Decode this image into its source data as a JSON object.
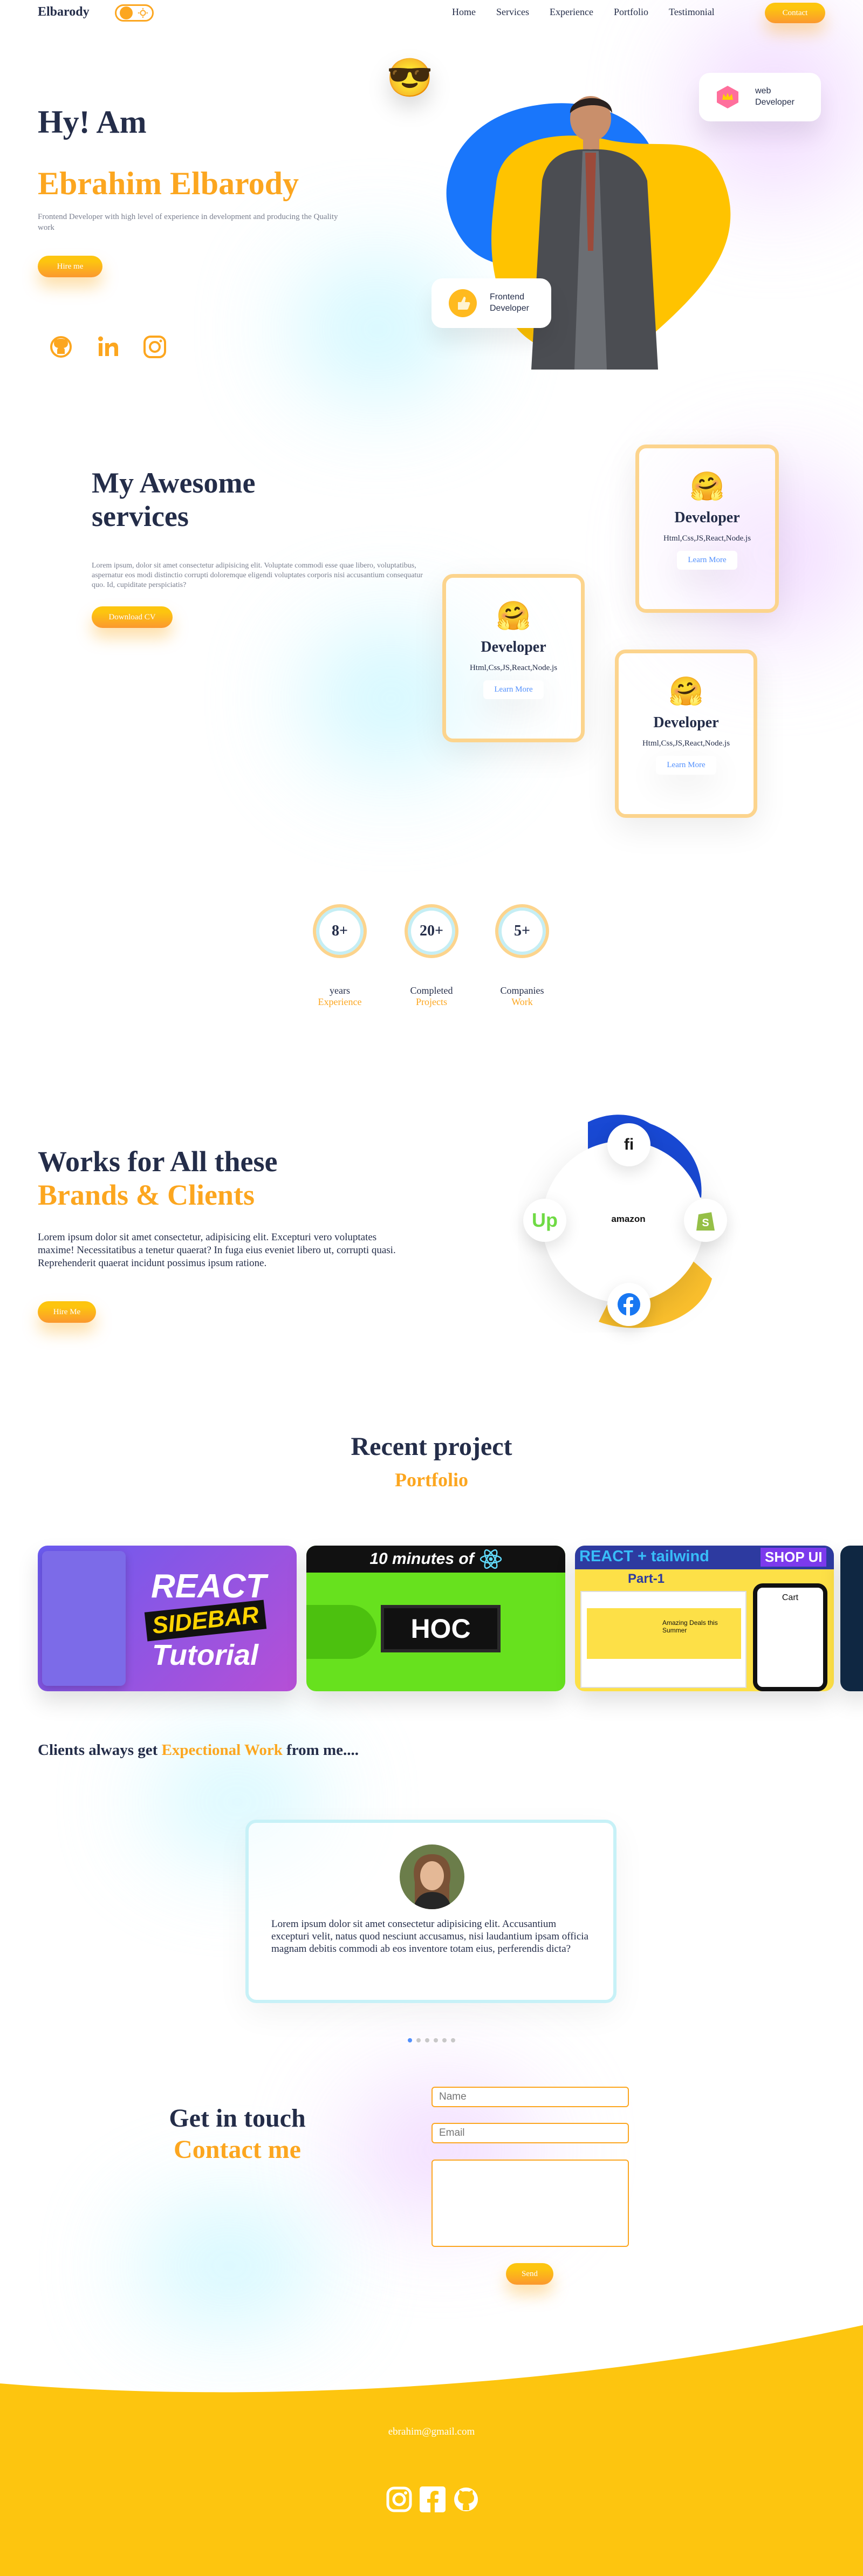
{
  "nav": {
    "logo": "Elbarody",
    "links": [
      "Home",
      "Services",
      "Experience",
      "Portfolio",
      "Testimonial"
    ],
    "contact_label": "Contact"
  },
  "hero": {
    "greeting": "Hy! Am",
    "name": "Ebrahim Elbarody",
    "description": "Frontend Developer with high level of experience in development and producing the Quality work",
    "hire_label": "Hire me",
    "badge_web": [
      "web",
      "Developer"
    ],
    "badge_frontend": [
      "Frontend",
      "Developer"
    ]
  },
  "services": {
    "title_line1": "My Awesome",
    "title_line2": "services",
    "description": "Lorem ipsum, dolor sit amet consectetur adipisicing elit. Voluptate commodi esse quae libero, voluptatibus, aspernatur eos modi distinctio corrupti doloremque eligendi voluptates corporis nisi accusantium consequatur quo. Id, cupiditate perspiciatis?",
    "cv_label": "Download CV",
    "cards": [
      {
        "emoji": "🤗",
        "title": "Developer",
        "sub": "Html,Css,JS,React,Node.js",
        "more": "Learn More"
      },
      {
        "emoji": "🤗",
        "title": "Developer",
        "sub": "Html,Css,JS,React,Node.js",
        "more": "Learn More"
      },
      {
        "emoji": "🤗",
        "title": "Developer",
        "sub": "Html,Css,JS,React,Node.js",
        "more": "Learn More"
      }
    ]
  },
  "stats": [
    {
      "value": "8+",
      "label": "years",
      "sub": "Experience"
    },
    {
      "value": "20+",
      "label": "Completed",
      "sub": "Projects"
    },
    {
      "value": "5+",
      "label": "Companies",
      "sub": "Work"
    }
  ],
  "works": {
    "title_line1": "Works for All these",
    "title_line2": "Brands & Clients",
    "description": "Lorem ipsum dolor sit amet consectetur, adipisicing elit. Excepturi vero voluptates maxime! Necessitatibus a tenetur quaerat? In fuga eius eveniet libero ut, corrupti quasi. Reprehenderit quaerat incidunt possimus ipsum ratione.",
    "hire_label": "Hire Me",
    "brands": [
      "fiverr",
      "Up",
      "amazon",
      "shopify",
      "f"
    ]
  },
  "portfolio": {
    "title": "Recent project",
    "subtitle": "Portfolio",
    "thumbs": [
      {
        "lines": [
          "REACT",
          "SIDEBAR",
          "Tutorial"
        ]
      },
      {
        "header": "10 minutes of",
        "main": "HOC"
      },
      {
        "header": "REACT + tailwind",
        "tag": "SHOP UI",
        "part": "Part-1",
        "deal": "Amazing Deals this Summer",
        "cart": "Cart"
      }
    ]
  },
  "testimonial": {
    "lead": "Clients always get ",
    "highlight": "Expectional Work",
    "tail": " from me....",
    "quote": "Lorem ipsum dolor sit amet consectetur adipisicing elit. Accusantium excepturi velit, natus quod nesciunt accusamus, nisi laudantium ipsam officia magnam debitis commodi ab eos inventore totam eius, perferendis dicta?"
  },
  "contact": {
    "title_line1": "Get in touch",
    "title_line2": "Contact me",
    "name_placeholder": "Name",
    "email_placeholder": "Email",
    "send_label": "Send"
  },
  "footer": {
    "email": "ebrahim@gmail.com"
  },
  "colors": {
    "orange": "#fca61f",
    "navy": "#242d49",
    "blue": "#5290fd",
    "footer": "#fdc50f"
  }
}
